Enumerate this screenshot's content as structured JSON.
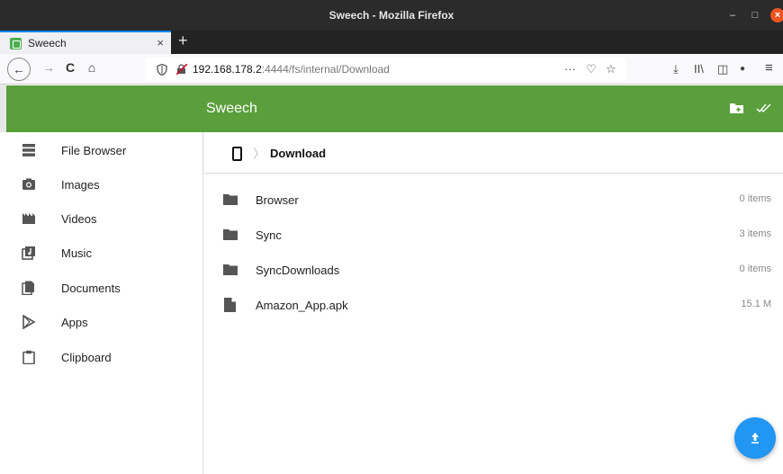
{
  "window": {
    "title": "Sweech - Mozilla Firefox",
    "minimize": "–",
    "maximize": "□",
    "close": "×"
  },
  "tab": {
    "label": "Sweech",
    "close": "×",
    "new_tab": "+"
  },
  "nav": {
    "back": "←",
    "forward": "→",
    "reload": "C",
    "home": "⌂",
    "url_host": "192.168.178.2",
    "url_path": ":4444/fs/internal/Download",
    "page_actions": "···",
    "pocket": "♡",
    "bookmark": "☆",
    "download": "⤓",
    "library": "II\\",
    "sidebar": "◫",
    "account": "●",
    "menu": "≡"
  },
  "appbar": {
    "title": "Sweech",
    "accent": "#5a9f3c"
  },
  "sidebar": {
    "items": [
      {
        "label": "File Browser",
        "icon": "storage-icon"
      },
      {
        "label": "Images",
        "icon": "camera-icon"
      },
      {
        "label": "Videos",
        "icon": "movie-icon"
      },
      {
        "label": "Music",
        "icon": "music-library-icon"
      },
      {
        "label": "Documents",
        "icon": "document-icon"
      },
      {
        "label": "Apps",
        "icon": "play-store-icon"
      },
      {
        "label": "Clipboard",
        "icon": "clipboard-icon"
      }
    ]
  },
  "breadcrumb": {
    "current": "Download",
    "separator": "〉"
  },
  "files": [
    {
      "name": "Browser",
      "meta": "0 items",
      "type": "folder"
    },
    {
      "name": "Sync",
      "meta": "3 items",
      "type": "folder"
    },
    {
      "name": "SyncDownloads",
      "meta": "0 items",
      "type": "folder"
    },
    {
      "name": "Amazon_App.apk",
      "meta": "15.1 M",
      "type": "file"
    }
  ],
  "fab": {
    "icon": "upload-icon",
    "color": "#2196f3"
  }
}
